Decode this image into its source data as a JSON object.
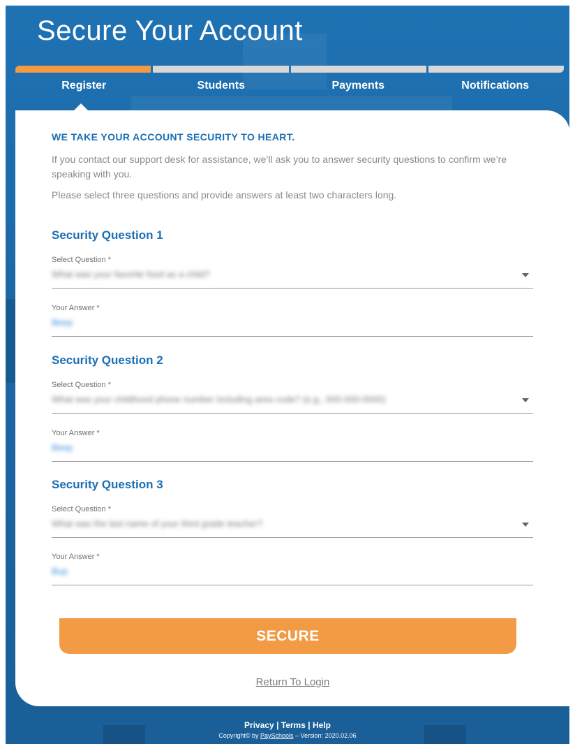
{
  "header": {
    "title": "Secure Your Account",
    "steps": [
      {
        "label": "Register",
        "active": true
      },
      {
        "label": "Students",
        "active": false
      },
      {
        "label": "Payments",
        "active": false
      },
      {
        "label": "Notifications",
        "active": false
      }
    ],
    "progress_active_color": "#f39a42"
  },
  "card": {
    "headline": "WE TAKE YOUR ACCOUNT SECURITY TO HEART.",
    "intro": "If you contact our support desk for assistance, we’ll ask you to answer security questions to confirm we’re speaking with you.",
    "note": "Please select three questions and provide answers at least two characters long.",
    "questions": [
      {
        "title": "Security Question 1",
        "select_label": "Select Question *",
        "select_value": "What was your favorite food as a child?",
        "answer_label": "Your Answer *",
        "answer_value": "Beep"
      },
      {
        "title": "Security Question 2",
        "select_label": "Select Question *",
        "select_value": "What was your childhood phone number including area code? (e.g., 000-000-0000)",
        "answer_label": "Your Answer *",
        "answer_value": "Beep"
      },
      {
        "title": "Security Question 3",
        "select_label": "Select Question *",
        "select_value": "What was the last name of your third grade teacher?",
        "answer_label": "Your Answer *",
        "answer_value": "Bup"
      }
    ],
    "secure_button": "SECURE",
    "return_link": "Return To Login"
  },
  "footer": {
    "privacy": "Privacy",
    "terms": "Terms",
    "help": "Help",
    "separator": "|",
    "copyright_prefix": "Copyright© by ",
    "brand": "PaySchools",
    "version": " – Version: 2020.02.06"
  },
  "colors": {
    "brand_blue": "#1a6fb4",
    "accent_orange": "#f39a45",
    "background_blue": "#1f72b3"
  }
}
